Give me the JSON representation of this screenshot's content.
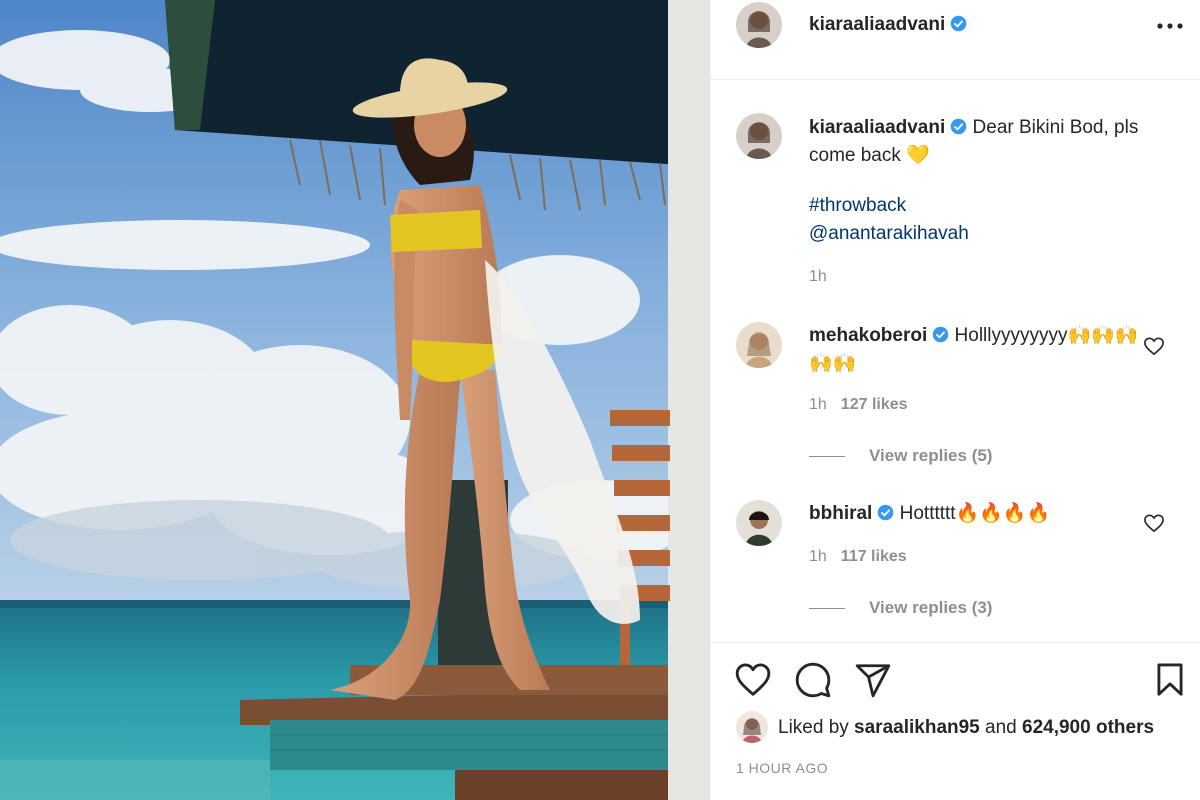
{
  "post": {
    "author": "kiaraaliaadvani",
    "verified": true,
    "photo_alt": ""
  },
  "header": {
    "username": "kiaraaliaadvani",
    "more_icon": "more-horizontal-icon"
  },
  "caption": {
    "username": "kiaraaliaadvani",
    "text": "Dear Bikini Bod, pls come back 💛",
    "hashtag": "#throwback",
    "mention": "@anantarakihavah",
    "time": "1h"
  },
  "comments": [
    {
      "username": "mehakoberoi",
      "text": "Holllyyyyyyyy🙌🙌🙌🙌🙌",
      "time": "1h",
      "likes": "127 likes",
      "view_replies": "View replies (5)"
    },
    {
      "username": "bbhiral",
      "text": "Hotttttt🔥🔥🔥🔥",
      "time": "1h",
      "likes": "117 likes",
      "view_replies": "View replies (3)"
    }
  ],
  "actions": {
    "like_icon": "heart-icon",
    "comment_icon": "comment-icon",
    "share_icon": "send-icon",
    "save_icon": "bookmark-icon"
  },
  "likes": {
    "prefix": "Liked by ",
    "user": "saraalikhan95",
    "middle": " and ",
    "count": "624,900 others"
  },
  "timestamp": "1 HOUR AGO",
  "colors": {
    "verified_blue": "#3897f0",
    "link_blue": "#00376b",
    "muted_gray": "#8e8e8e"
  }
}
